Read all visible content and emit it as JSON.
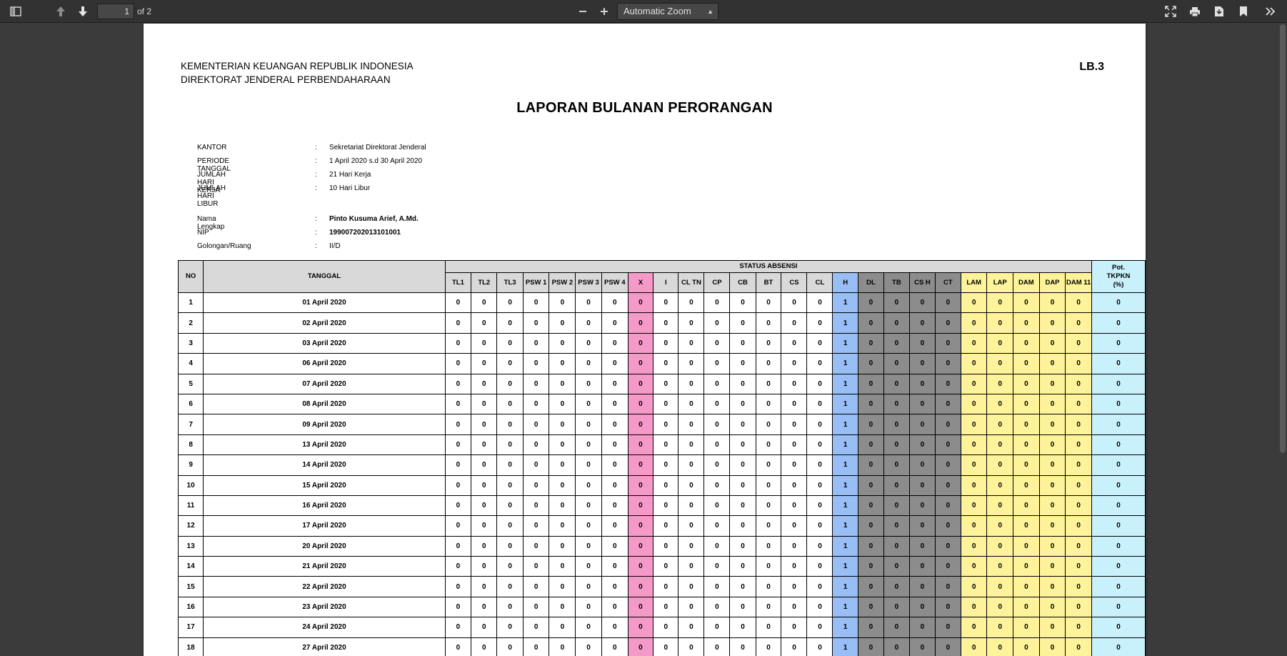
{
  "toolbar": {
    "page_current": "1",
    "page_total": "of 2",
    "zoom": "Automatic Zoom"
  },
  "header": {
    "org_line1": "KEMENTERIAN KEUANGAN REPUBLIK INDONESIA",
    "org_line2": "DIREKTORAT JENDERAL PERBENDAHARAAN",
    "code": "LB.3",
    "title": "LAPORAN BULANAN PERORANGAN"
  },
  "info_office": [
    {
      "key": "KANTOR",
      "value": "Sekretariat Direktorat Jenderal"
    },
    {
      "key": "PERIODE TANGGAL",
      "value": "1 April 2020 s.d 30 April 2020"
    },
    {
      "key": "JUMLAH HARI KERJA",
      "value": "21 Hari Kerja"
    },
    {
      "key": "JUMLAH HARI LIBUR",
      "value": "10 Hari Libur"
    }
  ],
  "info_person": [
    {
      "key": "Nama Lengkap",
      "value": "Pinto Kusuma Arief, A.Md.",
      "bold": true
    },
    {
      "key": "NIP",
      "value": "199007202013101001",
      "bold": true
    },
    {
      "key": "Golongan/Ruang",
      "value": "II/D",
      "bold": false
    }
  ],
  "colon": ":",
  "table": {
    "no_header": "NO",
    "date_header": "TANGGAL",
    "status_header": "STATUS ABSENSI",
    "pot_header": "Pot. TKPKN (%)",
    "status_columns": [
      {
        "label": "TL1",
        "color": ""
      },
      {
        "label": "TL2",
        "color": ""
      },
      {
        "label": "TL3",
        "color": ""
      },
      {
        "label": "PSW 1",
        "color": ""
      },
      {
        "label": "PSW 2",
        "color": ""
      },
      {
        "label": "PSW 3",
        "color": ""
      },
      {
        "label": "PSW 4",
        "color": ""
      },
      {
        "label": "X",
        "color": "pink"
      },
      {
        "label": "I",
        "color": ""
      },
      {
        "label": "CL TN",
        "color": ""
      },
      {
        "label": "CP",
        "color": ""
      },
      {
        "label": "CB",
        "color": ""
      },
      {
        "label": "BT",
        "color": ""
      },
      {
        "label": "CS",
        "color": ""
      },
      {
        "label": "CL",
        "color": ""
      },
      {
        "label": "H",
        "color": "blue"
      },
      {
        "label": "DL",
        "color": "gray"
      },
      {
        "label": "TB",
        "color": "gray"
      },
      {
        "label": "CS H",
        "color": "gray"
      },
      {
        "label": "CT",
        "color": "gray"
      },
      {
        "label": "LAM",
        "color": "yellow"
      },
      {
        "label": "LAP",
        "color": "yellow"
      },
      {
        "label": "DAM",
        "color": "yellow"
      },
      {
        "label": "DAP",
        "color": "yellow"
      },
      {
        "label": "DAM 11",
        "color": "yellow"
      }
    ],
    "rows": [
      {
        "no": "1",
        "date": "01 April 2020",
        "values": [
          "0",
          "0",
          "0",
          "0",
          "0",
          "0",
          "0",
          "0",
          "0",
          "0",
          "0",
          "0",
          "0",
          "0",
          "0",
          "1",
          "0",
          "0",
          "0",
          "0",
          "0",
          "0",
          "0",
          "0",
          "0"
        ],
        "pot": "0"
      },
      {
        "no": "2",
        "date": "02 April 2020",
        "values": [
          "0",
          "0",
          "0",
          "0",
          "0",
          "0",
          "0",
          "0",
          "0",
          "0",
          "0",
          "0",
          "0",
          "0",
          "0",
          "1",
          "0",
          "0",
          "0",
          "0",
          "0",
          "0",
          "0",
          "0",
          "0"
        ],
        "pot": "0"
      },
      {
        "no": "3",
        "date": "03 April 2020",
        "values": [
          "0",
          "0",
          "0",
          "0",
          "0",
          "0",
          "0",
          "0",
          "0",
          "0",
          "0",
          "0",
          "0",
          "0",
          "0",
          "1",
          "0",
          "0",
          "0",
          "0",
          "0",
          "0",
          "0",
          "0",
          "0"
        ],
        "pot": "0"
      },
      {
        "no": "4",
        "date": "06 April 2020",
        "values": [
          "0",
          "0",
          "0",
          "0",
          "0",
          "0",
          "0",
          "0",
          "0",
          "0",
          "0",
          "0",
          "0",
          "0",
          "0",
          "1",
          "0",
          "0",
          "0",
          "0",
          "0",
          "0",
          "0",
          "0",
          "0"
        ],
        "pot": "0"
      },
      {
        "no": "5",
        "date": "07 April 2020",
        "values": [
          "0",
          "0",
          "0",
          "0",
          "0",
          "0",
          "0",
          "0",
          "0",
          "0",
          "0",
          "0",
          "0",
          "0",
          "0",
          "1",
          "0",
          "0",
          "0",
          "0",
          "0",
          "0",
          "0",
          "0",
          "0"
        ],
        "pot": "0"
      },
      {
        "no": "6",
        "date": "08 April 2020",
        "values": [
          "0",
          "0",
          "0",
          "0",
          "0",
          "0",
          "0",
          "0",
          "0",
          "0",
          "0",
          "0",
          "0",
          "0",
          "0",
          "1",
          "0",
          "0",
          "0",
          "0",
          "0",
          "0",
          "0",
          "0",
          "0"
        ],
        "pot": "0"
      },
      {
        "no": "7",
        "date": "09 April 2020",
        "values": [
          "0",
          "0",
          "0",
          "0",
          "0",
          "0",
          "0",
          "0",
          "0",
          "0",
          "0",
          "0",
          "0",
          "0",
          "0",
          "1",
          "0",
          "0",
          "0",
          "0",
          "0",
          "0",
          "0",
          "0",
          "0"
        ],
        "pot": "0"
      },
      {
        "no": "8",
        "date": "13 April 2020",
        "values": [
          "0",
          "0",
          "0",
          "0",
          "0",
          "0",
          "0",
          "0",
          "0",
          "0",
          "0",
          "0",
          "0",
          "0",
          "0",
          "1",
          "0",
          "0",
          "0",
          "0",
          "0",
          "0",
          "0",
          "0",
          "0"
        ],
        "pot": "0"
      },
      {
        "no": "9",
        "date": "14 April 2020",
        "values": [
          "0",
          "0",
          "0",
          "0",
          "0",
          "0",
          "0",
          "0",
          "0",
          "0",
          "0",
          "0",
          "0",
          "0",
          "0",
          "1",
          "0",
          "0",
          "0",
          "0",
          "0",
          "0",
          "0",
          "0",
          "0"
        ],
        "pot": "0"
      },
      {
        "no": "10",
        "date": "15 April 2020",
        "values": [
          "0",
          "0",
          "0",
          "0",
          "0",
          "0",
          "0",
          "0",
          "0",
          "0",
          "0",
          "0",
          "0",
          "0",
          "0",
          "1",
          "0",
          "0",
          "0",
          "0",
          "0",
          "0",
          "0",
          "0",
          "0"
        ],
        "pot": "0"
      },
      {
        "no": "11",
        "date": "16 April 2020",
        "values": [
          "0",
          "0",
          "0",
          "0",
          "0",
          "0",
          "0",
          "0",
          "0",
          "0",
          "0",
          "0",
          "0",
          "0",
          "0",
          "1",
          "0",
          "0",
          "0",
          "0",
          "0",
          "0",
          "0",
          "0",
          "0"
        ],
        "pot": "0"
      },
      {
        "no": "12",
        "date": "17 April 2020",
        "values": [
          "0",
          "0",
          "0",
          "0",
          "0",
          "0",
          "0",
          "0",
          "0",
          "0",
          "0",
          "0",
          "0",
          "0",
          "0",
          "1",
          "0",
          "0",
          "0",
          "0",
          "0",
          "0",
          "0",
          "0",
          "0"
        ],
        "pot": "0"
      },
      {
        "no": "13",
        "date": "20 April 2020",
        "values": [
          "0",
          "0",
          "0",
          "0",
          "0",
          "0",
          "0",
          "0",
          "0",
          "0",
          "0",
          "0",
          "0",
          "0",
          "0",
          "1",
          "0",
          "0",
          "0",
          "0",
          "0",
          "0",
          "0",
          "0",
          "0"
        ],
        "pot": "0"
      },
      {
        "no": "14",
        "date": "21 April 2020",
        "values": [
          "0",
          "0",
          "0",
          "0",
          "0",
          "0",
          "0",
          "0",
          "0",
          "0",
          "0",
          "0",
          "0",
          "0",
          "0",
          "1",
          "0",
          "0",
          "0",
          "0",
          "0",
          "0",
          "0",
          "0",
          "0"
        ],
        "pot": "0"
      },
      {
        "no": "15",
        "date": "22 April 2020",
        "values": [
          "0",
          "0",
          "0",
          "0",
          "0",
          "0",
          "0",
          "0",
          "0",
          "0",
          "0",
          "0",
          "0",
          "0",
          "0",
          "1",
          "0",
          "0",
          "0",
          "0",
          "0",
          "0",
          "0",
          "0",
          "0"
        ],
        "pot": "0"
      },
      {
        "no": "16",
        "date": "23 April 2020",
        "values": [
          "0",
          "0",
          "0",
          "0",
          "0",
          "0",
          "0",
          "0",
          "0",
          "0",
          "0",
          "0",
          "0",
          "0",
          "0",
          "1",
          "0",
          "0",
          "0",
          "0",
          "0",
          "0",
          "0",
          "0",
          "0"
        ],
        "pot": "0"
      },
      {
        "no": "17",
        "date": "24 April 2020",
        "values": [
          "0",
          "0",
          "0",
          "0",
          "0",
          "0",
          "0",
          "0",
          "0",
          "0",
          "0",
          "0",
          "0",
          "0",
          "0",
          "1",
          "0",
          "0",
          "0",
          "0",
          "0",
          "0",
          "0",
          "0",
          "0"
        ],
        "pot": "0"
      },
      {
        "no": "18",
        "date": "27 April 2020",
        "values": [
          "0",
          "0",
          "0",
          "0",
          "0",
          "0",
          "0",
          "0",
          "0",
          "0",
          "0",
          "0",
          "0",
          "0",
          "0",
          "1",
          "0",
          "0",
          "0",
          "0",
          "0",
          "0",
          "0",
          "0",
          "0"
        ],
        "pot": "0"
      }
    ]
  }
}
